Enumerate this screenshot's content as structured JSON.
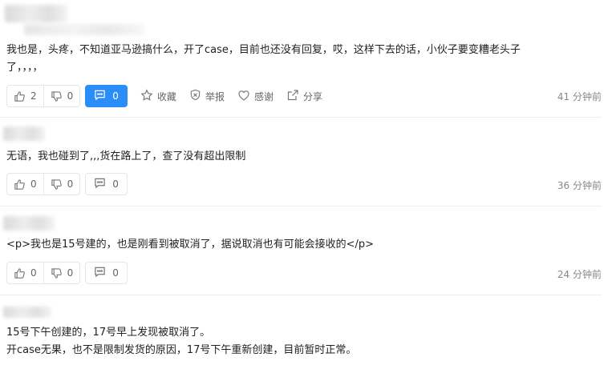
{
  "comments": [
    {
      "text_line1": "我也是，头疼，不知道亚马逊搞什么，开了case，目前也还没有回复，哎，这样下去的话，小伙子要变糟老头子",
      "text_line2": "了，，，，",
      "likes": "2",
      "dislikes": "0",
      "replies": "0",
      "reply_active": true,
      "collect_label": "收藏",
      "report_label": "举报",
      "thanks_label": "感谢",
      "share_label": "分享",
      "time": "41 分钟前"
    },
    {
      "text_line1": "无语，我也碰到了,,,货在路上了，查了没有超出限制",
      "likes": "0",
      "dislikes": "0",
      "replies": "0",
      "time": "36 分钟前"
    },
    {
      "text_line1": "<p>我也是15号建的，也是刚看到被取消了，据说取消也有可能会接收的</p>",
      "likes": "0",
      "dislikes": "0",
      "replies": "0",
      "time": "24 分钟前"
    },
    {
      "text_line1": "15号下午创建的，17号早上发现被取消了。",
      "text_line2": "开case无果，也不是限制发货的原因，17号下午重新创建，目前暂时正常。"
    }
  ],
  "colors": {
    "accent": "#2b8df7",
    "text": "#222222",
    "muted": "#888888",
    "border": "#e6e6e6"
  },
  "icons": [
    "thumb-up-icon",
    "thumb-down-icon",
    "comment-icon",
    "star-icon",
    "shield-icon",
    "heart-icon",
    "share-icon"
  ]
}
